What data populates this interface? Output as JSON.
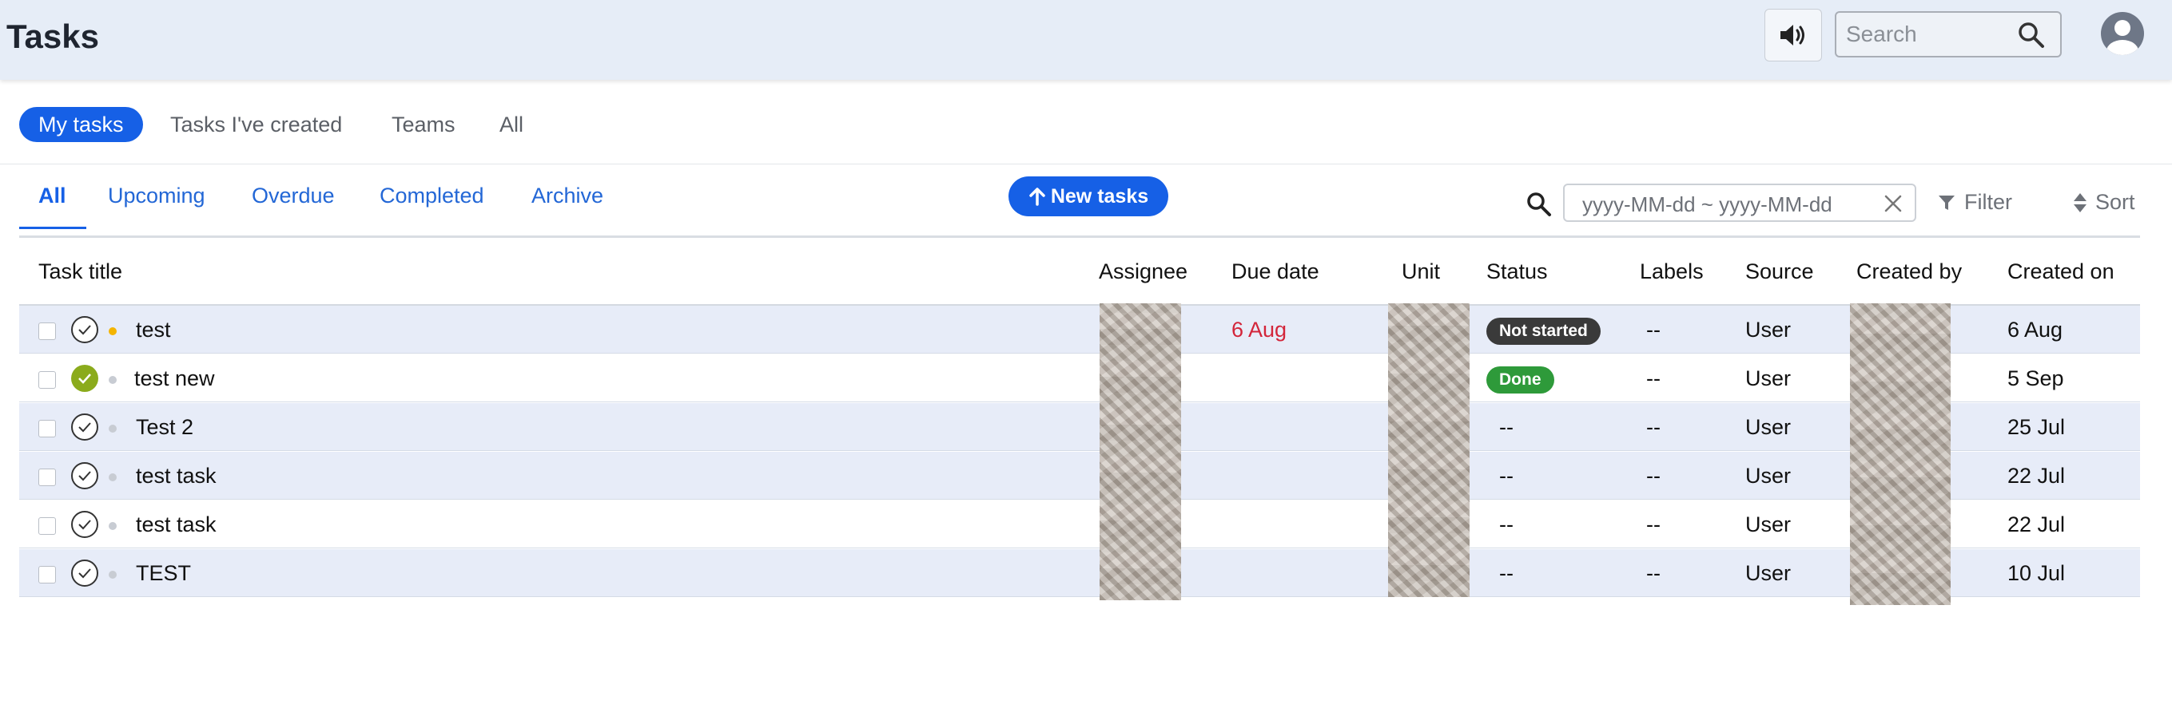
{
  "header": {
    "title": "Tasks",
    "search_placeholder": "Search",
    "icons": {
      "sound": "speaker-icon",
      "search": "search-icon",
      "avatar": "user-avatar-icon"
    }
  },
  "primary_tabs": [
    "My tasks",
    "Tasks I've created",
    "Teams",
    "All"
  ],
  "secondary_tabs": [
    "All",
    "Upcoming",
    "Overdue",
    "Completed",
    "Archive"
  ],
  "new_task_label": "New tasks",
  "date_filter_placeholder": "yyyy-MM-dd ~ yyyy-MM-dd",
  "filter_label": "Filter",
  "sort_label": "Sort",
  "colors": {
    "accent": "#1660e6",
    "overdue": "#d3253a",
    "status_not_started": "#3a3a3a",
    "status_done": "#2e9a3a",
    "priority_high": "#f4b400",
    "priority_none": "#c8ccd3",
    "completed_check": "#8bab1c"
  },
  "table": {
    "columns": [
      "Task title",
      "Assignee",
      "Due date",
      "Unit",
      "Status",
      "Labels",
      "Source",
      "Created by",
      "Created on"
    ],
    "rows": [
      {
        "title": "test",
        "due": "6 Aug",
        "status": "Not started",
        "labels": "--",
        "source": "User",
        "created_on": "6 Aug"
      },
      {
        "title": "test new",
        "due": "",
        "status": "Done",
        "labels": "--",
        "source": "User",
        "created_on": "5 Sep"
      },
      {
        "title": "Test 2",
        "due": "",
        "status": "--",
        "labels": "--",
        "source": "User",
        "created_on": "25 Jul"
      },
      {
        "title": "test task",
        "due": "",
        "status": "--",
        "labels": "--",
        "source": "User",
        "created_on": "22 Jul"
      },
      {
        "title": "test task",
        "due": "",
        "status": "--",
        "labels": "--",
        "source": "User",
        "created_on": "22 Jul"
      },
      {
        "title": "TEST",
        "due": "",
        "status": "--",
        "labels": "--",
        "source": "User",
        "created_on": "10 Jul"
      }
    ]
  }
}
